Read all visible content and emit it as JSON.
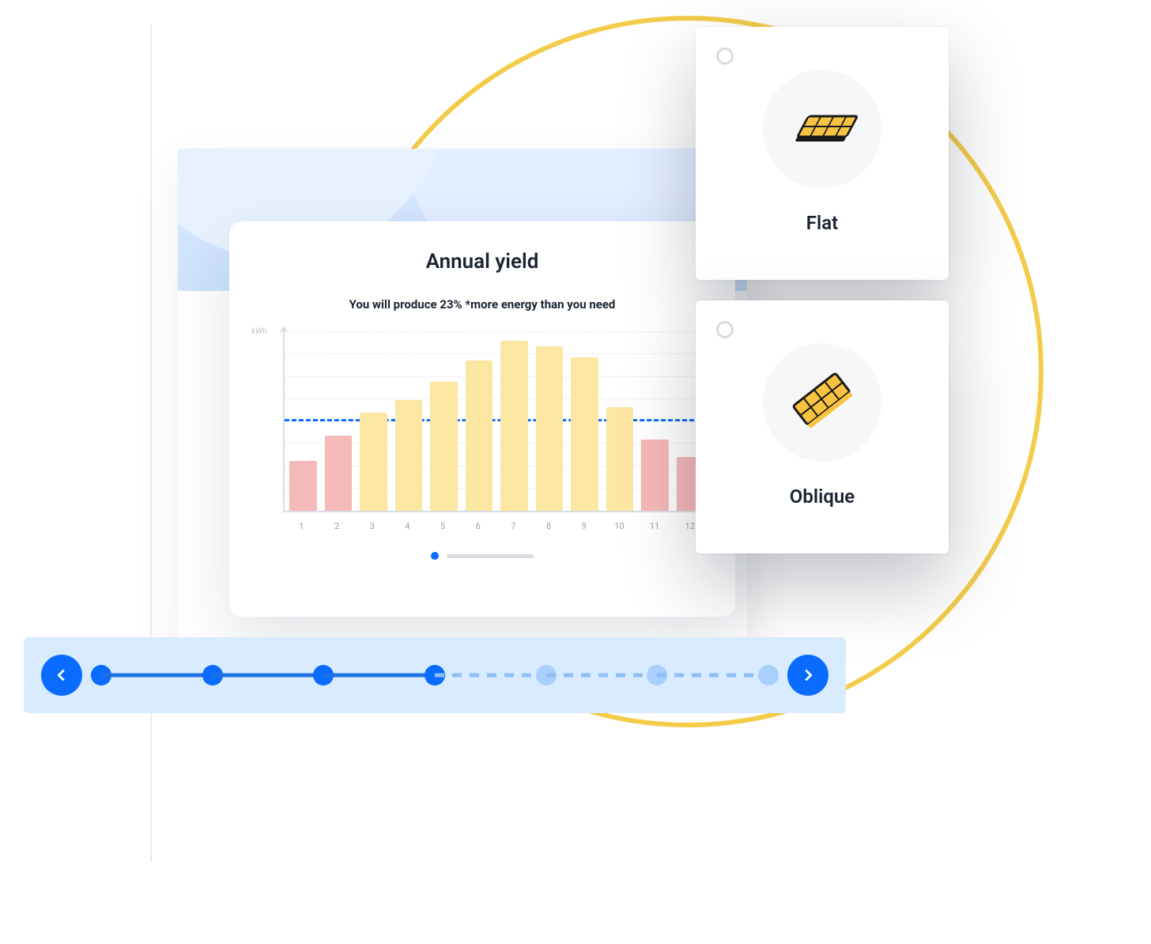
{
  "chart": {
    "title": "Annual yield",
    "subtitle": "You will produce 23% *more energy than you need",
    "ylabel": "kWh"
  },
  "chart_data": {
    "type": "bar",
    "title": "Annual yield",
    "xlabel": "",
    "ylabel": "kWh",
    "ylim": [
      0,
      100
    ],
    "threshold": 50,
    "categories": [
      "1",
      "2",
      "3",
      "4",
      "5",
      "6",
      "7",
      "8",
      "9",
      "10",
      "11",
      "12"
    ],
    "values": [
      28,
      42,
      55,
      62,
      72,
      84,
      95,
      92,
      86,
      58,
      40,
      30
    ],
    "series_color_rule": "value >= threshold ? high(yellow) : low(red)"
  },
  "options": [
    {
      "id": "flat",
      "label": "Flat"
    },
    {
      "id": "oblique",
      "label": "Oblique"
    }
  ],
  "progress": {
    "total_steps": 7,
    "current_step": 4
  }
}
